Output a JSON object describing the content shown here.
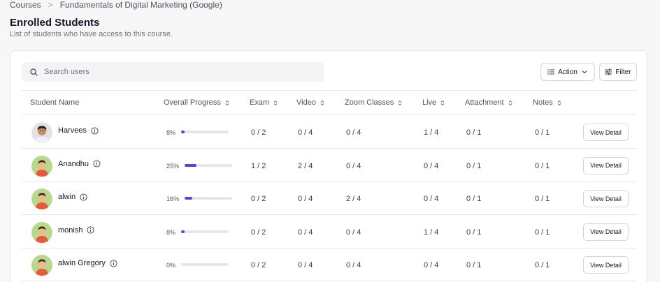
{
  "breadcrumb": {
    "root": "Courses",
    "separator": ">",
    "current": "Fundamentals of Digital Marketing (Google)"
  },
  "header": {
    "title": "Enrolled Students",
    "subtitle": "List of students who have access to this course."
  },
  "search": {
    "placeholder": "Search users",
    "value": "",
    "icon": "search-icon"
  },
  "toolbar": {
    "action_label": "Action",
    "filter_label": "Filter"
  },
  "table": {
    "columns": [
      "Student Name",
      "Overall Progress",
      "Exam",
      "Video",
      "Zoom Classes",
      "Live",
      "Attachment",
      "Notes"
    ],
    "view_label": "View Detail",
    "rows": [
      {
        "name": "Harvees",
        "avatar": "photo",
        "progress": "8%",
        "progress_value": 8,
        "exam": "0 / 2",
        "video": "0 / 4",
        "zoom": "0 / 4",
        "live": "1 / 4",
        "attachment": "0 / 1",
        "notes": "0 / 1"
      },
      {
        "name": "Anandhu",
        "avatar": "default",
        "progress": "25%",
        "progress_value": 25,
        "exam": "1 / 2",
        "video": "2 / 4",
        "zoom": "0 / 4",
        "live": "0 / 4",
        "attachment": "0 / 1",
        "notes": "0 / 1"
      },
      {
        "name": "alwin",
        "avatar": "default",
        "progress": "16%",
        "progress_value": 16,
        "exam": "0 / 2",
        "video": "0 / 4",
        "zoom": "2 / 4",
        "live": "0 / 4",
        "attachment": "0 / 1",
        "notes": "0 / 1"
      },
      {
        "name": "monish",
        "avatar": "default",
        "progress": "8%",
        "progress_value": 8,
        "exam": "0 / 2",
        "video": "0 / 4",
        "zoom": "0 / 4",
        "live": "1 / 4",
        "attachment": "0 / 1",
        "notes": "0 / 1"
      },
      {
        "name": "alwin Gregory",
        "avatar": "default",
        "progress": "0%",
        "progress_value": 0,
        "exam": "0 / 2",
        "video": "0 / 4",
        "zoom": "0 / 4",
        "live": "0 / 4",
        "attachment": "0 / 1",
        "notes": "0 / 1"
      }
    ]
  },
  "colors": {
    "accent": "#4f46e5",
    "track": "#e5e7eb",
    "avatar_bg": "#b7d98e",
    "avatar_shirt": "#e85a3c"
  }
}
